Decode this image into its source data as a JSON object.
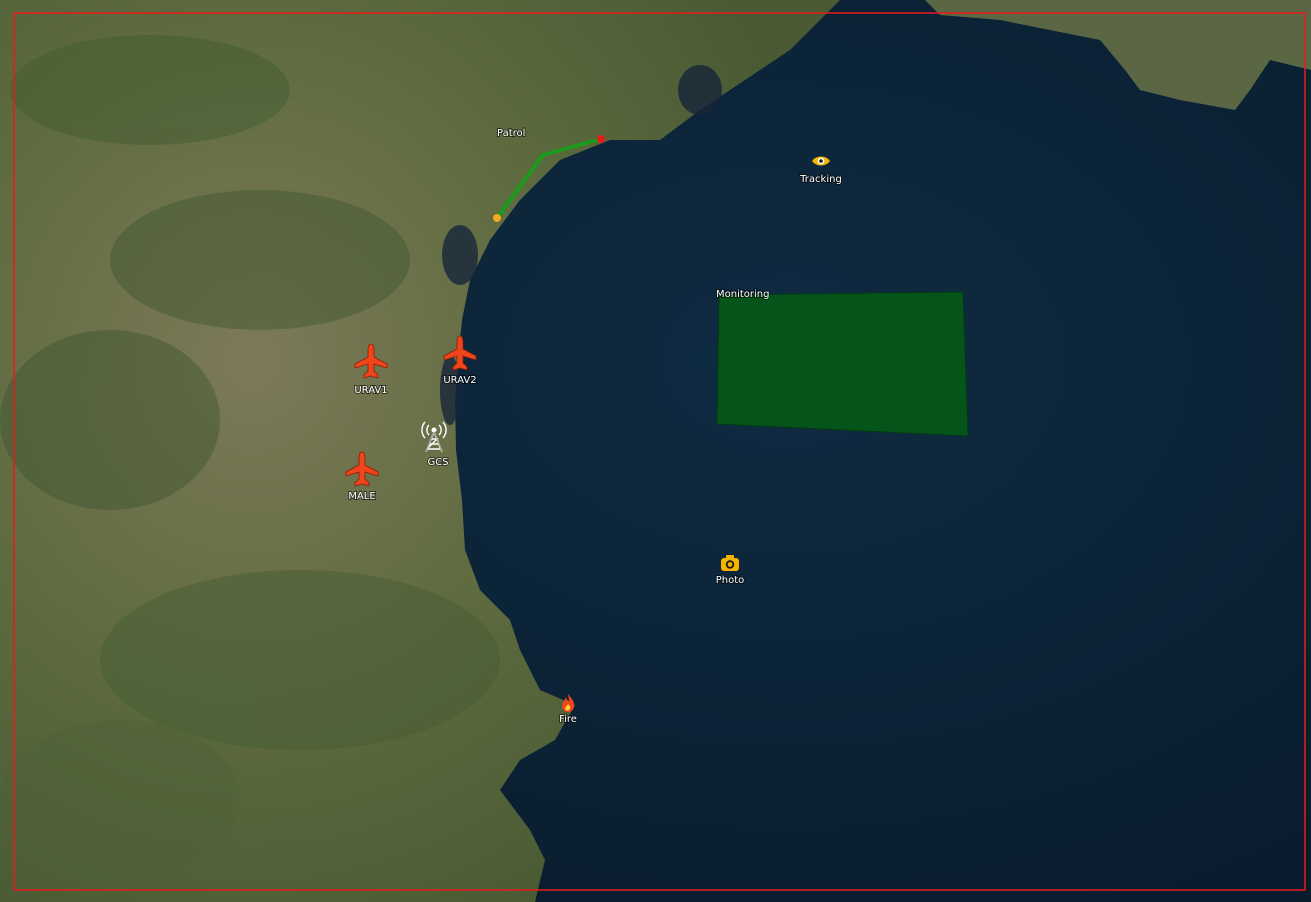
{
  "map": {
    "frame_color": "#e81b1b",
    "colors": {
      "sea": "#0d2336",
      "land": "#6b6f4a",
      "zone_fill": "#05551a",
      "route": "#1c9a1c",
      "route_start": "#f2a91c",
      "route_end": "#e81b1b",
      "aircraft": "#f0441a",
      "poi": "#f4b400"
    },
    "route": {
      "label": "Patrol"
    },
    "zone": {
      "label": "Monitoring"
    },
    "aircraft": [
      {
        "label": "URAV1",
        "icon": "airplane-icon"
      },
      {
        "label": "URAV2",
        "icon": "airplane-icon"
      },
      {
        "label": "MALE",
        "icon": "airplane-icon"
      }
    ],
    "station": {
      "label": "GCS",
      "icon": "antenna-tower-icon"
    },
    "points": [
      {
        "label": "Tracking",
        "icon": "eye-icon"
      },
      {
        "label": "Photo",
        "icon": "camera-icon"
      },
      {
        "label": "Fire",
        "icon": "fire-icon"
      }
    ]
  }
}
